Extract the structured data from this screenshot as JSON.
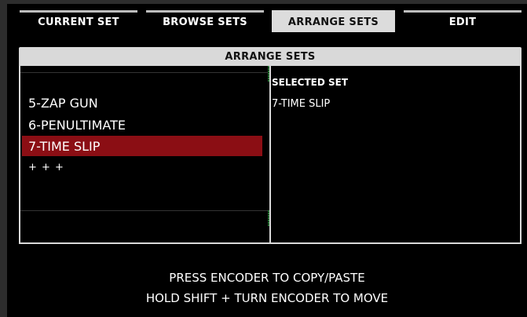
{
  "tabs": [
    {
      "label": "CURRENT SET"
    },
    {
      "label": "BROWSE SETS"
    },
    {
      "label": "ARRANGE SETS"
    },
    {
      "label": "EDIT"
    }
  ],
  "panel": {
    "title": "ARRANGE SETS",
    "set_list": [
      "5-ZAP GUN",
      "6-PENULTIMATE",
      "7-TIME SLIP",
      "+ + +"
    ],
    "selected_index": 2,
    "selected_set_label": "SELECTED SET",
    "selected_set_value": "7-TIME SLIP"
  },
  "footer": {
    "line1": "PRESS ENCODER TO COPY/PASTE",
    "line2": "HOLD SHIFT + TURN ENCODER TO MOVE"
  },
  "colors": {
    "selection": "#8b0e14",
    "active_tab": "#dcdcdc"
  }
}
